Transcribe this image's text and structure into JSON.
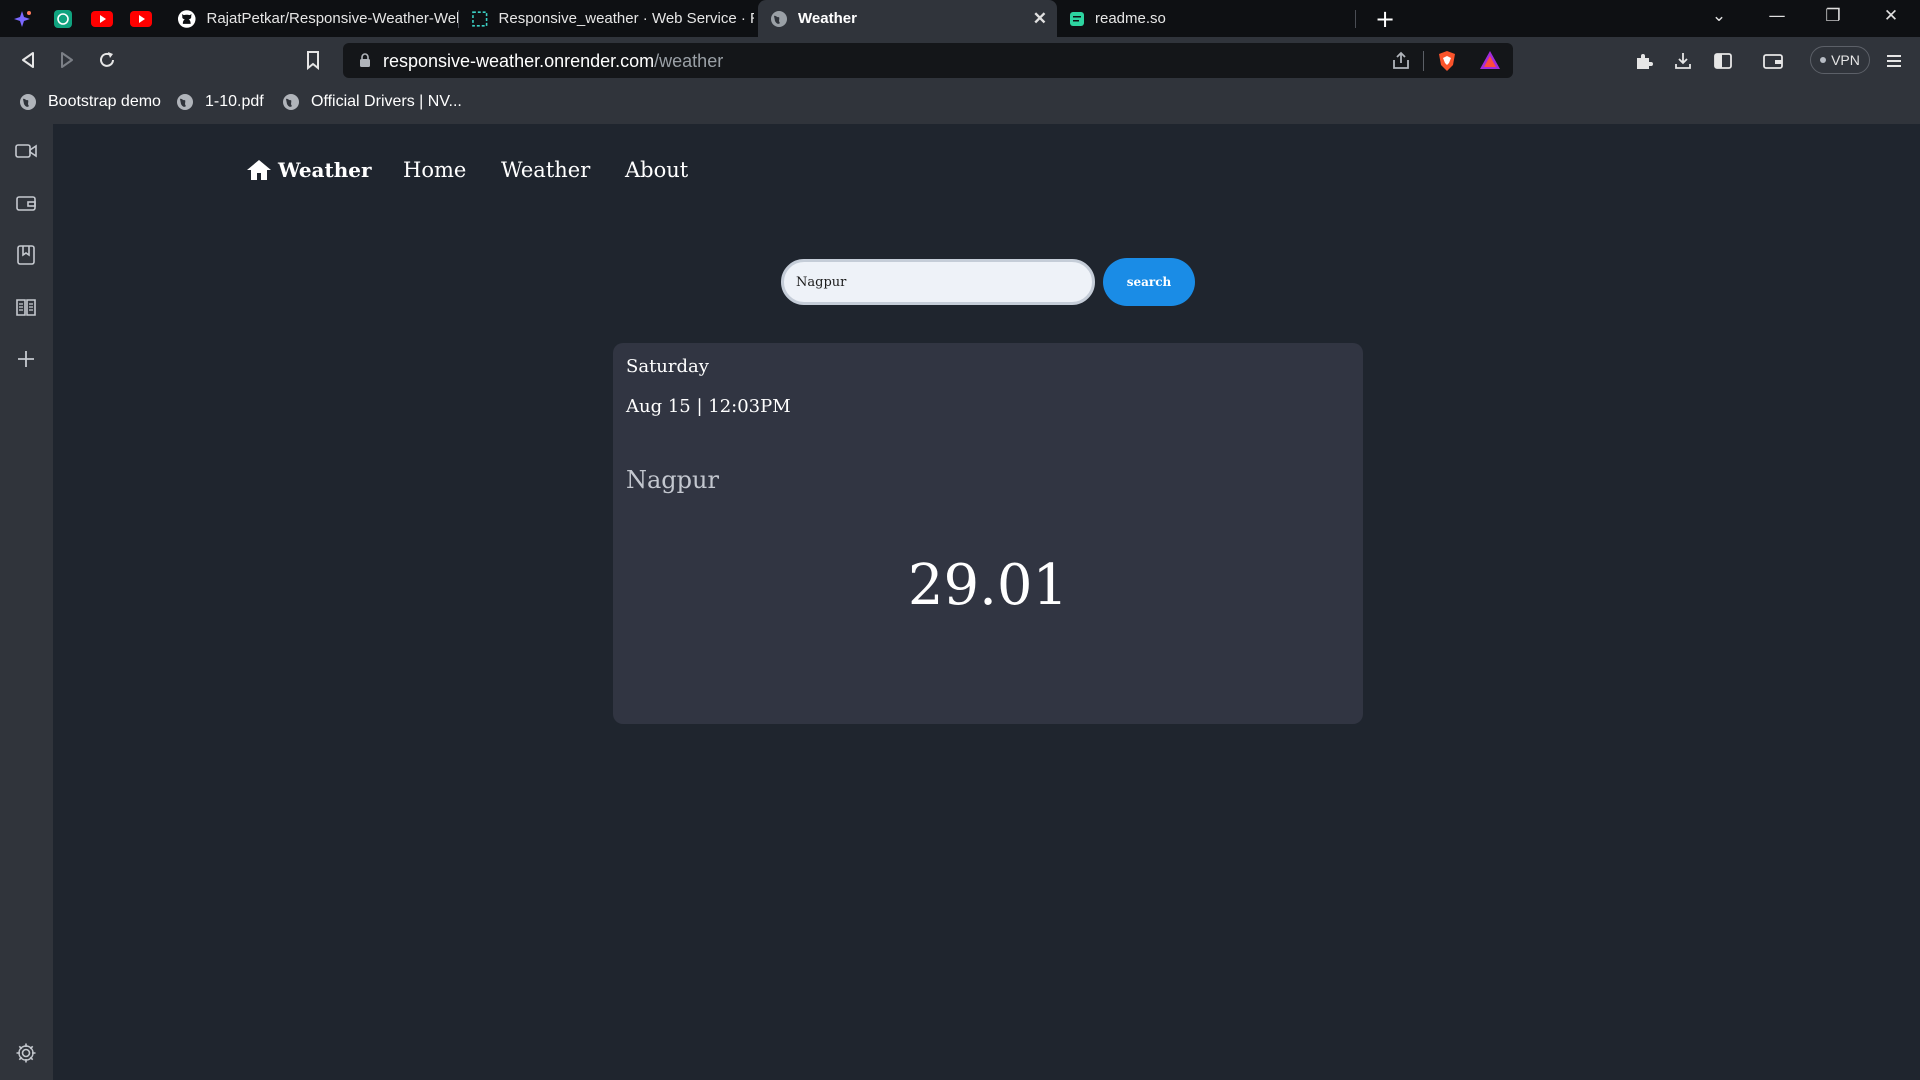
{
  "browser": {
    "tabs": [
      {
        "title": "RajatPetkar/Responsive-Weather-Web",
        "icon": "github-icon"
      },
      {
        "title": "Responsive_weather · Web Service · R",
        "icon": "render-icon"
      },
      {
        "title": "Weather",
        "icon": "globe-icon",
        "active": true
      },
      {
        "title": "readme.so",
        "icon": "readme-icon"
      }
    ],
    "pinned_icons": [
      "leo-ai-icon",
      "chatgpt-icon",
      "youtube-icon",
      "youtube-icon"
    ],
    "url_host": "responsive-weather.onrender.com",
    "url_path": "/weather",
    "vpn_label": "VPN",
    "bookmarks": [
      {
        "label": "Bootstrap demo"
      },
      {
        "label": "1-10.pdf"
      },
      {
        "label": "Official Drivers | NV..."
      }
    ]
  },
  "page": {
    "brand": "Weather",
    "nav": [
      {
        "label": "Home"
      },
      {
        "label": "Weather"
      },
      {
        "label": "About"
      }
    ],
    "search": {
      "value": "Nagpur",
      "button_label": "search"
    },
    "card": {
      "day": "Saturday",
      "datetime": "Aug 15 | 12:03PM",
      "city": "Nagpur",
      "temperature": "29.01"
    }
  },
  "colors": {
    "page_bg": "#1f252e",
    "card_bg": "#313542",
    "search_button": "#1a8ce6",
    "chrome_bg": "#30343b",
    "tabstrip_bg": "#0e1013"
  }
}
